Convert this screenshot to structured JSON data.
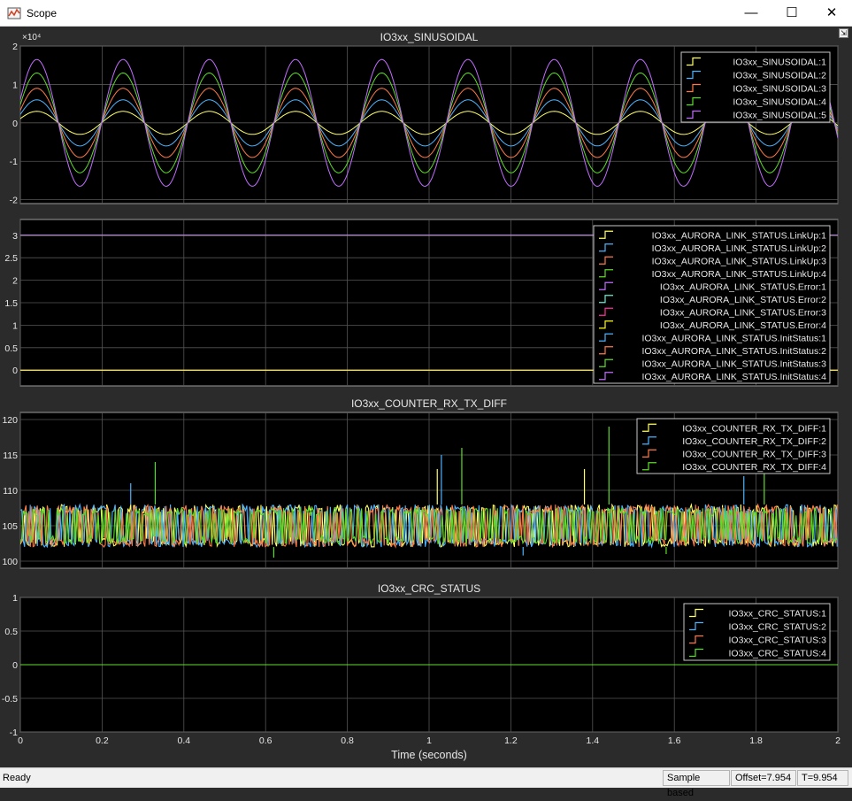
{
  "window": {
    "title": "Scope",
    "minimize_glyph": "—",
    "maximize_glyph": "☐",
    "close_glyph": "✕",
    "dock_glyph": "⇲"
  },
  "statusbar": {
    "ready": "Ready",
    "mode": "Sample based",
    "offset": "Offset=7.954",
    "time": "T=9.954"
  },
  "chart_data": [
    {
      "type": "line",
      "title": "IO3xx_SINUSOIDAL",
      "xlabel": "",
      "ylabel": "",
      "exponent_label": "×10⁴",
      "xlim": [
        0,
        2
      ],
      "ylim": [
        -2.1,
        2
      ],
      "yticks": [
        -2,
        -1,
        0,
        1,
        2
      ],
      "yticklabels": [
        "-2",
        "-1",
        "0",
        "1",
        "2"
      ],
      "grid": true,
      "legend_position": "top-right",
      "frequency_hz": 4.74,
      "phase": 0.37,
      "series": [
        {
          "name": "IO3xx_SINUSOIDAL:1",
          "color": "#ffff66",
          "amplitude": 0.3
        },
        {
          "name": "IO3xx_SINUSOIDAL:2",
          "color": "#4db3ff",
          "amplitude": 0.6
        },
        {
          "name": "IO3xx_SINUSOIDAL:3",
          "color": "#ff7a45",
          "amplitude": 0.9
        },
        {
          "name": "IO3xx_SINUSOIDAL:4",
          "color": "#5edc2a",
          "amplitude": 1.3
        },
        {
          "name": "IO3xx_SINUSOIDAL:5",
          "color": "#c26cff",
          "amplitude": 1.65
        }
      ]
    },
    {
      "type": "line",
      "title": "",
      "xlim": [
        0,
        2
      ],
      "ylim": [
        -0.35,
        3.35
      ],
      "yticks": [
        0,
        0.5,
        1,
        1.5,
        2,
        2.5,
        3
      ],
      "yticklabels": [
        "0",
        "0.5",
        "1",
        "1.5",
        "2",
        "2.5",
        "3"
      ],
      "grid": true,
      "legend_position": "top-right",
      "series": [
        {
          "name": "IO3xx_AURORA_LINK_STATUS.LinkUp:1",
          "color": "#ffff66",
          "value": 0
        },
        {
          "name": "IO3xx_AURORA_LINK_STATUS.LinkUp:2",
          "color": "#4db3ff",
          "value": 0
        },
        {
          "name": "IO3xx_AURORA_LINK_STATUS.LinkUp:3",
          "color": "#ff7a45",
          "value": 0
        },
        {
          "name": "IO3xx_AURORA_LINK_STATUS.LinkUp:4",
          "color": "#5edc2a",
          "value": 0
        },
        {
          "name": "IO3xx_AURORA_LINK_STATUS.Error:1",
          "color": "#c26cff",
          "value": 0
        },
        {
          "name": "IO3xx_AURORA_LINK_STATUS.Error:2",
          "color": "#66f0d0",
          "value": 0
        },
        {
          "name": "IO3xx_AURORA_LINK_STATUS.Error:3",
          "color": "#ff3399",
          "value": 0
        },
        {
          "name": "IO3xx_AURORA_LINK_STATUS.Error:4",
          "color": "#ffff00",
          "value": 0
        },
        {
          "name": "IO3xx_AURORA_LINK_STATUS.InitStatus:1",
          "color": "#4db3ff",
          "value": 3
        },
        {
          "name": "IO3xx_AURORA_LINK_STATUS.InitStatus:2",
          "color": "#ff7a45",
          "value": 3
        },
        {
          "name": "IO3xx_AURORA_LINK_STATUS.InitStatus:3",
          "color": "#5edc2a",
          "value": 3
        },
        {
          "name": "IO3xx_AURORA_LINK_STATUS.InitStatus:4",
          "color": "#c26cff",
          "value": 3
        }
      ]
    },
    {
      "type": "line",
      "title": "IO3xx_COUNTER_RX_TX_DIFF",
      "xlim": [
        0,
        2
      ],
      "ylim": [
        99,
        121
      ],
      "yticks": [
        100,
        105,
        110,
        115,
        120
      ],
      "yticklabels": [
        "100",
        "105",
        "110",
        "115",
        "120"
      ],
      "grid": true,
      "legend_position": "top-right",
      "value_band": [
        102,
        108
      ],
      "spikes": [
        {
          "x": 0.27,
          "y": 111,
          "series": 2
        },
        {
          "x": 0.33,
          "y": 114,
          "series": 4
        },
        {
          "x": 1.02,
          "y": 113,
          "series": 1
        },
        {
          "x": 1.03,
          "y": 115,
          "series": 2
        },
        {
          "x": 1.08,
          "y": 116,
          "series": 4
        },
        {
          "x": 1.38,
          "y": 113,
          "series": 1
        },
        {
          "x": 1.44,
          "y": 119,
          "series": 4
        },
        {
          "x": 1.77,
          "y": 112,
          "series": 2
        },
        {
          "x": 1.82,
          "y": 113,
          "series": 4
        },
        {
          "x": 0.62,
          "y": 100.5,
          "series": 4
        },
        {
          "x": 1.23,
          "y": 100.8,
          "series": 2
        },
        {
          "x": 1.58,
          "y": 101,
          "series": 4
        }
      ],
      "series": [
        {
          "name": "IO3xx_COUNTER_RX_TX_DIFF:1",
          "color": "#ffff66"
        },
        {
          "name": "IO3xx_COUNTER_RX_TX_DIFF:2",
          "color": "#4db3ff"
        },
        {
          "name": "IO3xx_COUNTER_RX_TX_DIFF:3",
          "color": "#ff7a45"
        },
        {
          "name": "IO3xx_COUNTER_RX_TX_DIFF:4",
          "color": "#5edc2a"
        }
      ]
    },
    {
      "type": "line",
      "title": "IO3xx_CRC_STATUS",
      "xlabel": "Time (seconds)",
      "xlim": [
        0,
        2
      ],
      "ylim": [
        -1,
        1
      ],
      "xticks": [
        0,
        0.2,
        0.4,
        0.6,
        0.8,
        1,
        1.2,
        1.4,
        1.6,
        1.8,
        2
      ],
      "xticklabels": [
        "0",
        "0.2",
        "0.4",
        "0.6",
        "0.8",
        "1",
        "1.2",
        "1.4",
        "1.6",
        "1.8",
        "2"
      ],
      "yticks": [
        -1,
        -0.5,
        0,
        0.5,
        1
      ],
      "yticklabels": [
        "-1",
        "-0.5",
        "0",
        "0.5",
        "1"
      ],
      "grid": true,
      "legend_position": "top-right",
      "series": [
        {
          "name": "IO3xx_CRC_STATUS:1",
          "color": "#ffff66",
          "value": 0
        },
        {
          "name": "IO3xx_CRC_STATUS:2",
          "color": "#4db3ff",
          "value": 0
        },
        {
          "name": "IO3xx_CRC_STATUS:3",
          "color": "#ff7a45",
          "value": 0
        },
        {
          "name": "IO3xx_CRC_STATUS:4",
          "color": "#5edc2a",
          "value": 0
        }
      ]
    }
  ]
}
